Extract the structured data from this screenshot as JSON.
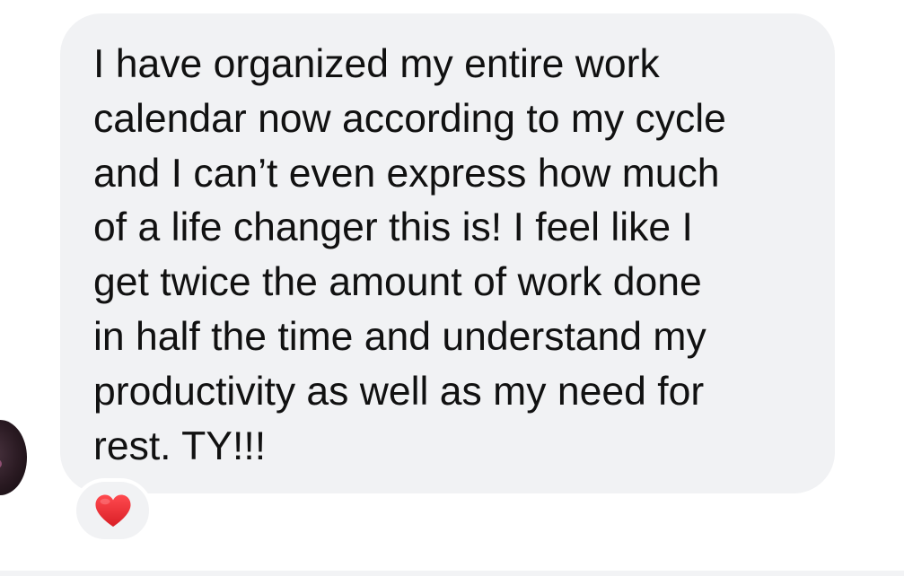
{
  "message": {
    "lines": [
      "I have organized my entire work",
      "calendar now according to my cycle",
      "and I can’t even express how much",
      "of a life changer this is! I feel like I",
      "get twice the amount of work done",
      "in half the time and understand my",
      "productivity as well as my need for",
      "rest. TY!!!"
    ]
  },
  "reaction": {
    "icon": "heart-emoji",
    "color": "#e5262c"
  },
  "colors": {
    "bubble": "#f1f2f4",
    "text": "#111111",
    "background": "#ffffff"
  }
}
